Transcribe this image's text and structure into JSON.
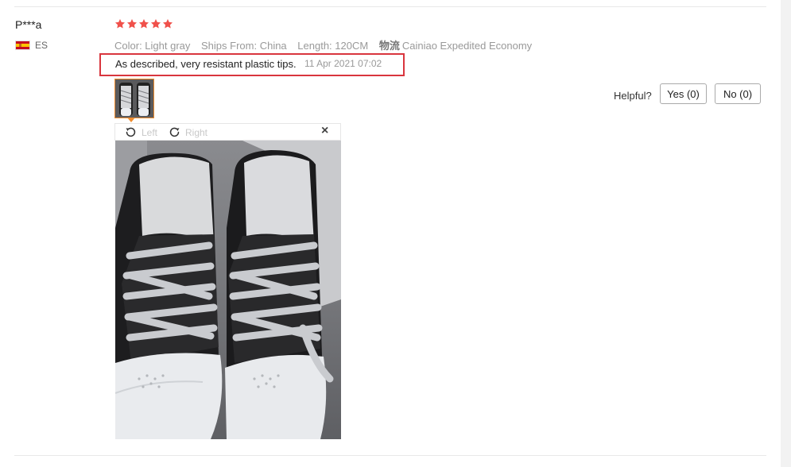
{
  "review": {
    "user": "P***a",
    "country": "ES",
    "rating": 5,
    "attributes": [
      {
        "key": "color",
        "text": "Color: Light gray"
      },
      {
        "key": "ships",
        "text": "Ships From: China"
      },
      {
        "key": "length",
        "text": "Length: 120CM"
      }
    ],
    "logistics_label": "物流",
    "logistics_value": "Cainiao Expedited Economy",
    "text": "As described, very resistant plastic tips.",
    "date": "11 Apr 2021 07:02"
  },
  "helpful": {
    "label": "Helpful?",
    "yes": "Yes (0)",
    "no": "No (0)"
  },
  "viewer": {
    "rotate_left": "Left",
    "rotate_right": "Right",
    "close": "×"
  },
  "colors": {
    "star": "#f0514b",
    "highlight": "#d9363e",
    "thumb_border": "#f08c2e"
  },
  "icons": [
    "star-icon",
    "rotate-left-icon",
    "rotate-right-icon",
    "close-icon",
    "spain-flag-icon"
  ]
}
